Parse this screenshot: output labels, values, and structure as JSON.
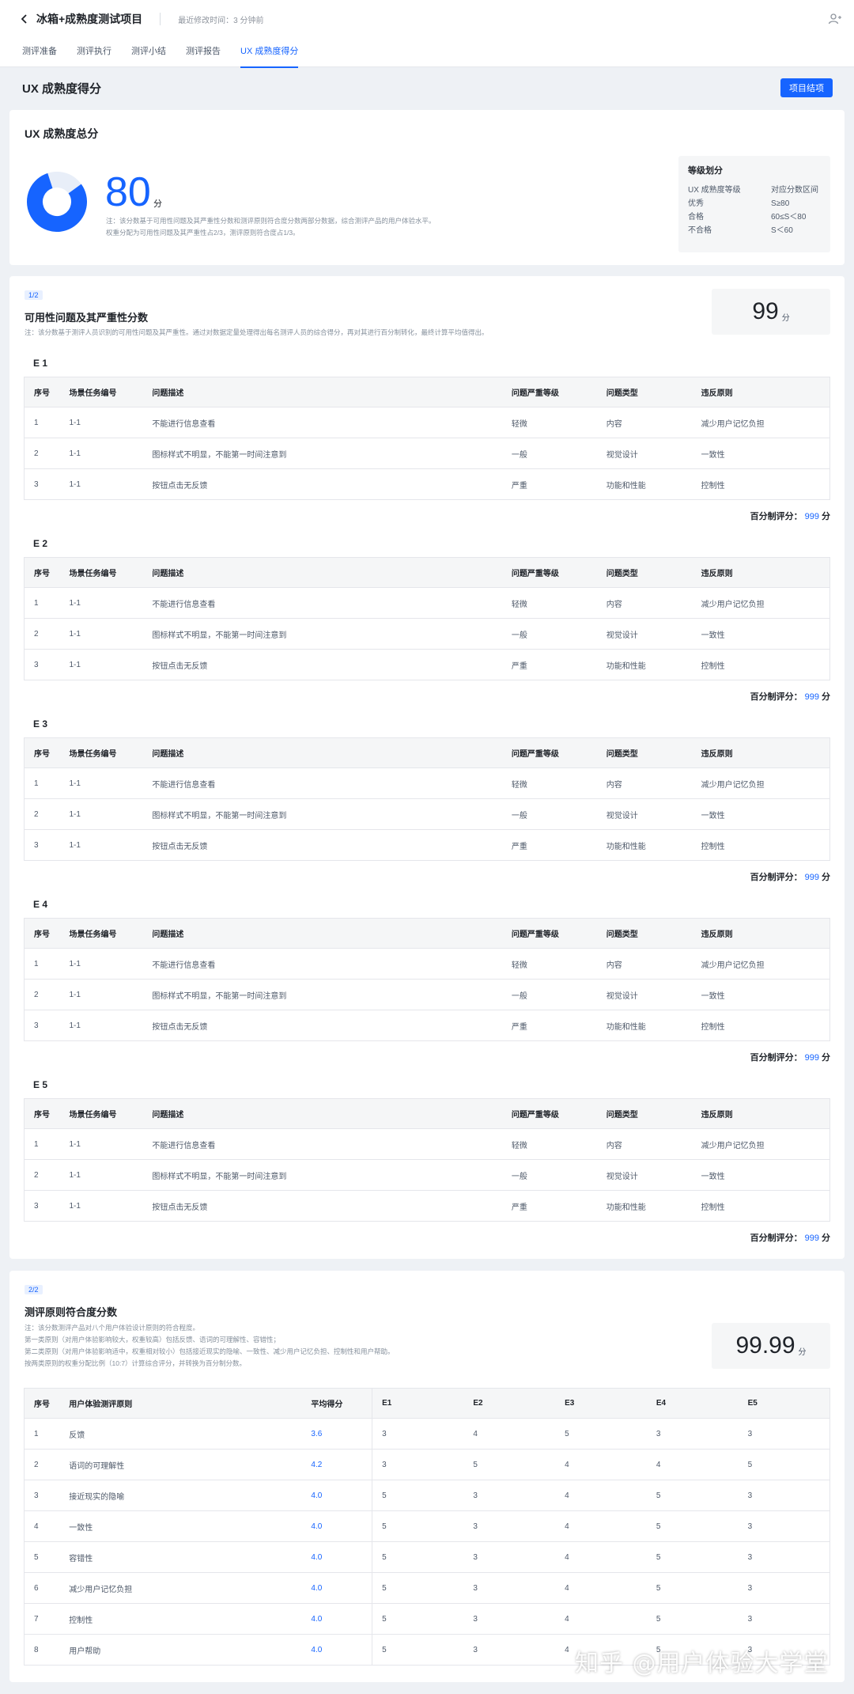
{
  "header": {
    "title": "冰箱+成熟度测试项目",
    "last_modified": "最近修改时间：3 分钟前"
  },
  "tabs": [
    {
      "label": "测评准备"
    },
    {
      "label": "测评执行"
    },
    {
      "label": "测评小结"
    },
    {
      "label": "测评报告"
    },
    {
      "label": "UX 成熟度得分"
    }
  ],
  "page": {
    "title": "UX 成熟度得分",
    "end_button": "项目结项"
  },
  "summary": {
    "title": "UX 成熟度总分",
    "score": "80",
    "unit": "分",
    "score_fraction": 0.8,
    "note_line1": "注：该分数基于可用性问题及其严重性分数和测评原则符合度分数两部分数据，综合测评产品的用户体验水平。",
    "note_line2": "权重分配为可用性问题及其严重性占2/3，测评原则符合度占1/3。",
    "grade": {
      "title": "等级划分",
      "col1": "UX 成熟度等级",
      "col2": "对应分数区间",
      "rows": [
        {
          "level": "优秀",
          "range": "S≥80"
        },
        {
          "level": "合格",
          "range": "60≤S＜80"
        },
        {
          "level": "不合格",
          "range": "S＜60"
        }
      ]
    }
  },
  "usability": {
    "badge": "1/2",
    "title": "可用性问题及其严重性分数",
    "note": "注：该分数基于测评人员识别的可用性问题及其严重性。通过对数据定量处理得出每名测评人员的综合得分，再对其进行百分制转化，最终计算平均值得出。",
    "score": "99",
    "unit": "分",
    "columns": [
      "序号",
      "场景任务编号",
      "问题描述",
      "问题严重等级",
      "问题类型",
      "违反原则"
    ],
    "pct_label": "百分制评分：",
    "pct_unit": "分",
    "evaluators": [
      {
        "label": "E 1",
        "pct": "999",
        "rows": [
          [
            "1",
            "1-1",
            "不能进行信息查看",
            "轻微",
            "内容",
            "减少用户记忆负担"
          ],
          [
            "2",
            "1-1",
            "图标样式不明显，不能第一时间注意到",
            "一般",
            "视觉设计",
            "一致性"
          ],
          [
            "3",
            "1-1",
            "按钮点击无反馈",
            "严重",
            "功能和性能",
            "控制性"
          ]
        ]
      },
      {
        "label": "E 2",
        "pct": "999",
        "rows": [
          [
            "1",
            "1-1",
            "不能进行信息查看",
            "轻微",
            "内容",
            "减少用户记忆负担"
          ],
          [
            "2",
            "1-1",
            "图标样式不明显，不能第一时间注意到",
            "一般",
            "视觉设计",
            "一致性"
          ],
          [
            "3",
            "1-1",
            "按钮点击无反馈",
            "严重",
            "功能和性能",
            "控制性"
          ]
        ]
      },
      {
        "label": "E 3",
        "pct": "999",
        "rows": [
          [
            "1",
            "1-1",
            "不能进行信息查看",
            "轻微",
            "内容",
            "减少用户记忆负担"
          ],
          [
            "2",
            "1-1",
            "图标样式不明显，不能第一时间注意到",
            "一般",
            "视觉设计",
            "一致性"
          ],
          [
            "3",
            "1-1",
            "按钮点击无反馈",
            "严重",
            "功能和性能",
            "控制性"
          ]
        ]
      },
      {
        "label": "E 4",
        "pct": "999",
        "rows": [
          [
            "1",
            "1-1",
            "不能进行信息查看",
            "轻微",
            "内容",
            "减少用户记忆负担"
          ],
          [
            "2",
            "1-1",
            "图标样式不明显，不能第一时间注意到",
            "一般",
            "视觉设计",
            "一致性"
          ],
          [
            "3",
            "1-1",
            "按钮点击无反馈",
            "严重",
            "功能和性能",
            "控制性"
          ]
        ]
      },
      {
        "label": "E 5",
        "pct": "999",
        "rows": [
          [
            "1",
            "1-1",
            "不能进行信息查看",
            "轻微",
            "内容",
            "减少用户记忆负担"
          ],
          [
            "2",
            "1-1",
            "图标样式不明显，不能第一时间注意到",
            "一般",
            "视觉设计",
            "一致性"
          ],
          [
            "3",
            "1-1",
            "按钮点击无反馈",
            "严重",
            "功能和性能",
            "控制性"
          ]
        ]
      }
    ]
  },
  "principles": {
    "badge": "2/2",
    "title": "测评原则符合度分数",
    "note_lines": [
      "注：该分数测评产品对八个用户体验设计原则的符合程度。",
      "第一类原则（对用户体验影响较大，权重较高）包括反馈、语词的可理解性、容错性；",
      "第二类原则（对用户体验影响适中，权重相对较小）包括接近现实的隐喻、一致性、减少用户记忆负担、控制性和用户帮助。",
      "按两类原则的权重分配比例（10:7）计算综合评分，并转换为百分制分数。"
    ],
    "score": "99.99",
    "unit": "分",
    "columns": [
      "序号",
      "用户体验测评原则",
      "平均得分",
      "E1",
      "E2",
      "E3",
      "E4",
      "E5"
    ],
    "rows": [
      [
        "1",
        "反馈",
        "3.6",
        "3",
        "4",
        "5",
        "3",
        "3"
      ],
      [
        "2",
        "语词的可理解性",
        "4.2",
        "3",
        "5",
        "4",
        "4",
        "5"
      ],
      [
        "3",
        "接近现实的隐喻",
        "4.0",
        "5",
        "3",
        "4",
        "5",
        "3"
      ],
      [
        "4",
        "一致性",
        "4.0",
        "5",
        "3",
        "4",
        "5",
        "3"
      ],
      [
        "5",
        "容错性",
        "4.0",
        "5",
        "3",
        "4",
        "5",
        "3"
      ],
      [
        "6",
        "减少用户记忆负担",
        "4.0",
        "5",
        "3",
        "4",
        "5",
        "3"
      ],
      [
        "7",
        "控制性",
        "4.0",
        "5",
        "3",
        "4",
        "5",
        "3"
      ],
      [
        "8",
        "用户帮助",
        "4.0",
        "5",
        "3",
        "4",
        "5",
        "3"
      ]
    ]
  },
  "watermark": "知乎 @用户体验大学堂",
  "colors": {
    "accent": "#1664ff",
    "donut_rest": "#e8eef8"
  }
}
